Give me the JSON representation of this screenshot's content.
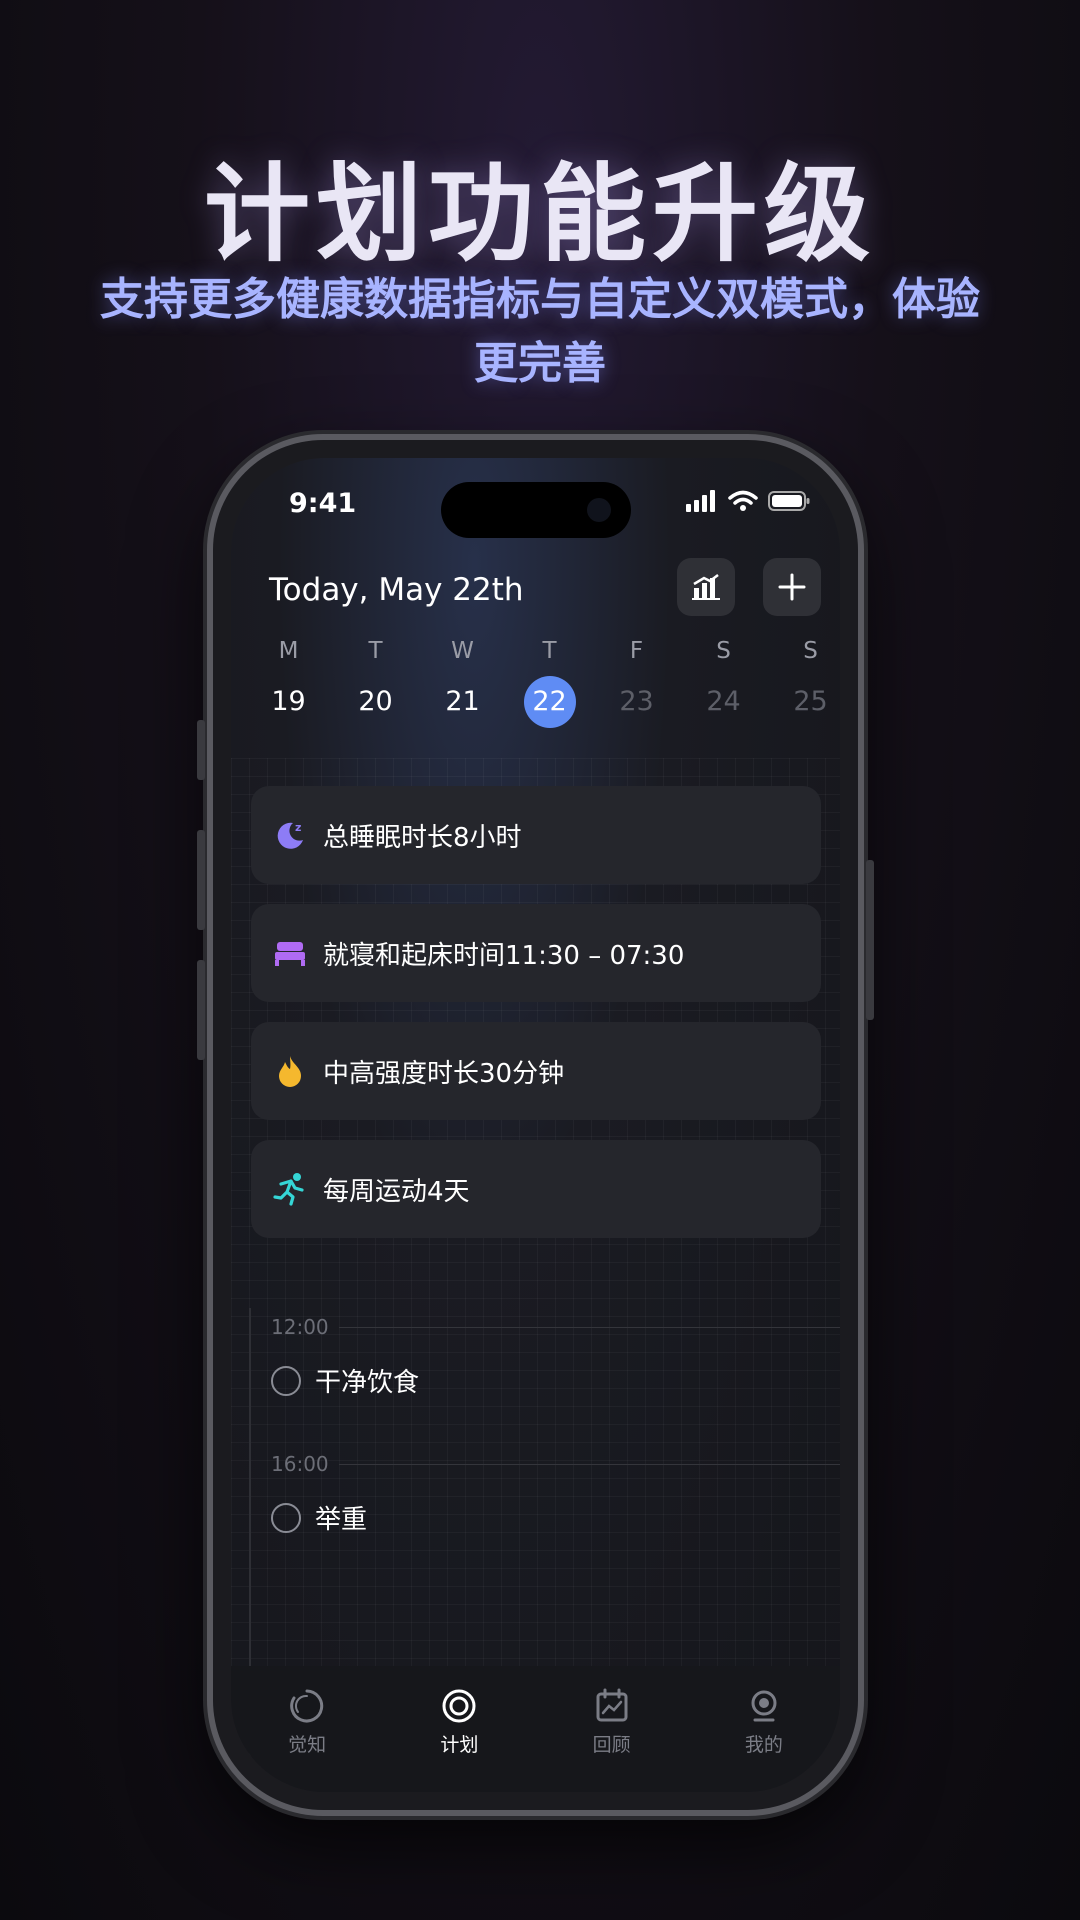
{
  "promo": {
    "headline": "计划功能升级",
    "subline": "支持更多健康数据指标与自定义双模式，体验更完善"
  },
  "status_bar": {
    "time": "9:41",
    "icons": [
      "signal-icon",
      "wifi-icon",
      "battery-icon"
    ]
  },
  "header": {
    "title": "Today, May 22th",
    "buttons": [
      "chart-icon",
      "plus-icon"
    ]
  },
  "week": {
    "days": [
      "M",
      "T",
      "W",
      "T",
      "F",
      "S",
      "S"
    ],
    "dates": [
      "19",
      "20",
      "21",
      "22",
      "23",
      "24",
      "25"
    ],
    "selected_index": 3
  },
  "goals": [
    {
      "icon": "moon-sleep-icon",
      "color": "#8d7cf6",
      "label": "总睡眠时长8小时"
    },
    {
      "icon": "bed-icon",
      "color": "#b06bf3",
      "label": "就寝和起床时间11:30 – 07:30"
    },
    {
      "icon": "flame-icon",
      "color": "#f5b82e",
      "label": "中高强度时长30分钟"
    },
    {
      "icon": "running-icon",
      "color": "#35d6d6",
      "label": "每周运动4天"
    }
  ],
  "timeline": [
    {
      "time": "12:00",
      "task": "干净饮食"
    },
    {
      "time": "16:00",
      "task": "举重"
    }
  ],
  "tabbar": {
    "items": [
      {
        "icon": "awareness-ring-icon",
        "label": "觉知",
        "active": false
      },
      {
        "icon": "plan-target-icon",
        "label": "计划",
        "active": true
      },
      {
        "icon": "review-calendar-icon",
        "label": "回顾",
        "active": false
      },
      {
        "icon": "profile-icon",
        "label": "我的",
        "active": false
      }
    ]
  },
  "colors": {
    "accent": "#5f8cf4",
    "card": "#25262c",
    "headline": "#e9e6f5",
    "subline": "#a8b4ff"
  }
}
